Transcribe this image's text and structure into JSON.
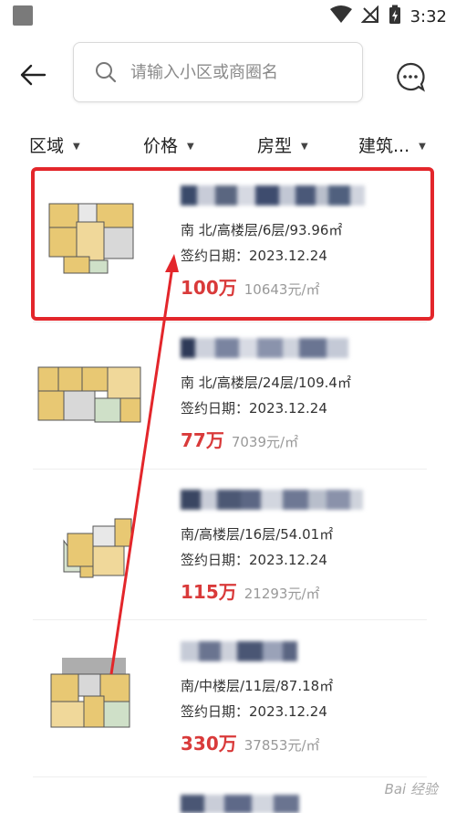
{
  "status": {
    "time": "3:32"
  },
  "search": {
    "placeholder": "请输入小区或商圈名",
    "value": ""
  },
  "filters": [
    {
      "label": "区域"
    },
    {
      "label": "价格"
    },
    {
      "label": "房型"
    },
    {
      "label": "建筑..."
    }
  ],
  "listings": [
    {
      "spec": "南 北/高楼层/6层/93.96㎡",
      "sign_date": "签约日期：2023.12.24",
      "price": "100万",
      "unit_price": "10643元/㎡"
    },
    {
      "spec": "南 北/高楼层/24层/109.4㎡",
      "sign_date": "签约日期：2023.12.24",
      "price": "77万",
      "unit_price": "7039元/㎡"
    },
    {
      "spec": "南/高楼层/16层/54.01㎡",
      "sign_date": "签约日期：2023.12.24",
      "price": "115万",
      "unit_price": "21293元/㎡"
    },
    {
      "spec": "南/中楼层/11层/87.18㎡",
      "sign_date": "签约日期：2023.12.24",
      "price": "330万",
      "unit_price": "37853元/㎡"
    }
  ],
  "icons": {
    "back": "back-arrow-icon",
    "search": "search-icon",
    "message": "message-icon",
    "wifi": "wifi-icon",
    "signal": "signal-off-icon",
    "battery": "battery-charging-icon"
  },
  "colors": {
    "accent_red": "#d93a3a",
    "highlight_red": "#e3262b"
  },
  "watermark": "Bai 经验"
}
